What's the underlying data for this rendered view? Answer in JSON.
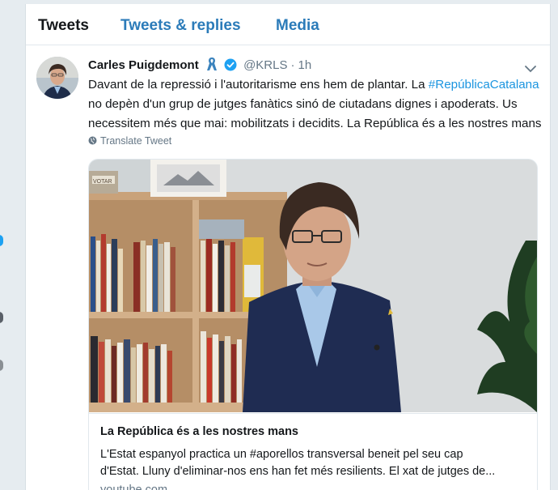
{
  "tabs": [
    {
      "label": "Tweets",
      "active": true
    },
    {
      "label": "Tweets & replies",
      "active": false
    },
    {
      "label": "Media",
      "active": false
    }
  ],
  "tweet": {
    "author_name": "Carles Puigdemont",
    "handle": "@KRLS",
    "separator": "·",
    "time": "1h",
    "text": {
      "line1_before": "Davant de la repressió i l'autoritarisme ens hem de plantar. La ",
      "hashtag": "#RepúblicaCatalana",
      "line2": "no depèn d'un grup de jutges fanàtics sinó de ciutadans dignes i apoderats. Us",
      "line3": "necessitem més que mai: mobilitzats i decidits. La República és a les nostres mans"
    },
    "translate_label": "Translate Tweet",
    "icons": {
      "ribbon": "yellow-ribbon-icon",
      "verified": "verified-badge-icon",
      "menu": "chevron-down-icon",
      "translate": "globe-icon"
    }
  },
  "card": {
    "title": "La República és a les nostres mans",
    "description_line1": "L'Estat espanyol practica un #aporellos transversal beneit pel seu cap",
    "description_line2": "d'Estat. Lluny d'eliminar-nos ens han fet més resilients. El xat de jutges de...",
    "domain": "youtube.com",
    "image_text": "VOTAR"
  },
  "colors": {
    "accent": "#1b95e0",
    "tab_accent": "#2b7bb9",
    "text": "#14171a",
    "muted": "#657786",
    "ribbon": "#3b83bd",
    "verified": "#1da1f2"
  }
}
